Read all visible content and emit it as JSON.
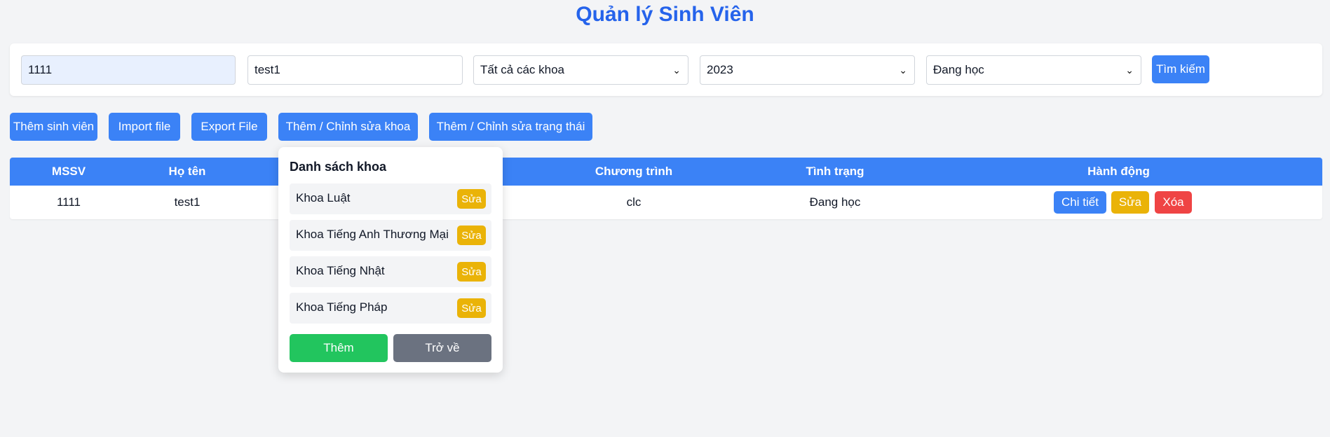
{
  "page": {
    "title": "Quản lý Sinh Viên"
  },
  "filters": {
    "mssv_value": "1111",
    "name_value": "test1",
    "faculty_selected": "Tất cả các khoa",
    "year_selected": "2023",
    "status_selected": "Đang học",
    "search_label": "Tìm kiếm"
  },
  "actions": {
    "add_student": "Thêm sinh viên",
    "import_file": "Import file",
    "export_file": "Export File",
    "edit_faculty": "Thêm / Chỉnh sửa khoa",
    "edit_status": "Thêm / Chỉnh sửa trạng thái"
  },
  "table": {
    "headers": [
      "MSSV",
      "Họ tên",
      "Chương trình",
      "Tình trạng",
      "Hành động"
    ],
    "rows": [
      {
        "mssv": "1111",
        "name": "test1",
        "program": "clc",
        "status": "Đang học"
      }
    ],
    "row_actions": {
      "detail": "Chi tiết",
      "edit": "Sửa",
      "delete": "Xóa"
    }
  },
  "faculty_popup": {
    "title": "Danh sách khoa",
    "items": [
      {
        "name": "Khoa Luật",
        "edit_label": "Sửa"
      },
      {
        "name": "Khoa Tiếng Anh Thương Mại",
        "edit_label": "Sửa"
      },
      {
        "name": "Khoa Tiếng Nhật",
        "edit_label": "Sửa"
      },
      {
        "name": "Khoa Tiếng Pháp",
        "edit_label": "Sửa"
      }
    ],
    "add_label": "Thêm",
    "back_label": "Trở về"
  },
  "colors": {
    "primary": "#3b82f6",
    "title": "#2563eb",
    "warning": "#eab308",
    "danger": "#ef4444",
    "success": "#22c55e",
    "secondary": "#6b7280"
  }
}
